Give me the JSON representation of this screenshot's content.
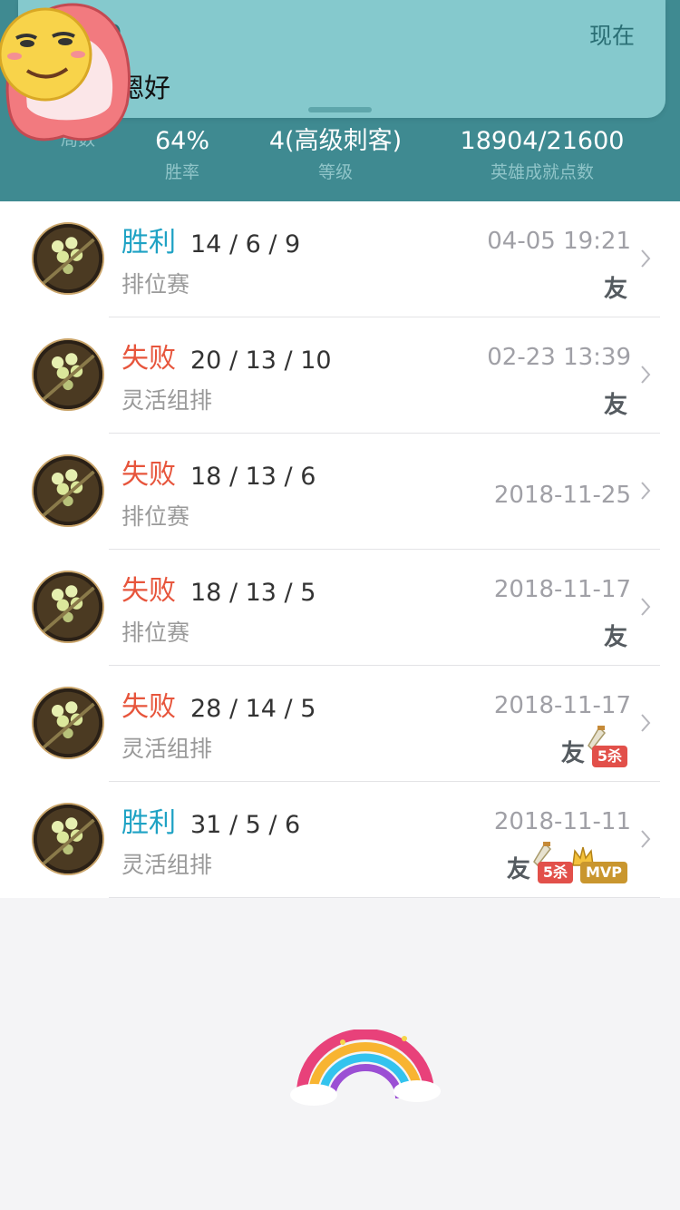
{
  "notification": {
    "app_name": "Q",
    "time": "现在",
    "message": "嗯好"
  },
  "stats": [
    {
      "value": "",
      "label": "局数"
    },
    {
      "value": "64%",
      "label": "胜率"
    },
    {
      "value": "4(高级刺客)",
      "label": "等级"
    },
    {
      "value": "18904/21600",
      "label": "英雄成就点数"
    }
  ],
  "matches": [
    {
      "result": "胜利",
      "kda": "14 / 6 / 9",
      "mode": "排位赛",
      "date": "04-05 19:21",
      "badges": {
        "friend": "友"
      }
    },
    {
      "result": "失败",
      "kda": "20 / 13 / 10",
      "mode": "灵活组排",
      "date": "02-23 13:39",
      "badges": {
        "friend": "友"
      }
    },
    {
      "result": "失败",
      "kda": "18 / 13 / 6",
      "mode": "排位赛",
      "date": "2018-11-25",
      "badges": {}
    },
    {
      "result": "失败",
      "kda": "18 / 13 / 5",
      "mode": "排位赛",
      "date": "2018-11-17",
      "badges": {
        "friend": "友"
      }
    },
    {
      "result": "失败",
      "kda": "28 / 14 / 5",
      "mode": "灵活组排",
      "date": "2018-11-17",
      "badges": {
        "friend": "友",
        "penta": "5杀"
      }
    },
    {
      "result": "胜利",
      "kda": "31 / 5 / 6",
      "mode": "灵活组排",
      "date": "2018-11-11",
      "badges": {
        "friend": "友",
        "penta": "5杀",
        "mvp": "MVP"
      }
    }
  ],
  "colors": {
    "header": "#3f8a91",
    "banner": "#85c9cd",
    "win": "#1ea2c4",
    "loss": "#e7553c"
  }
}
